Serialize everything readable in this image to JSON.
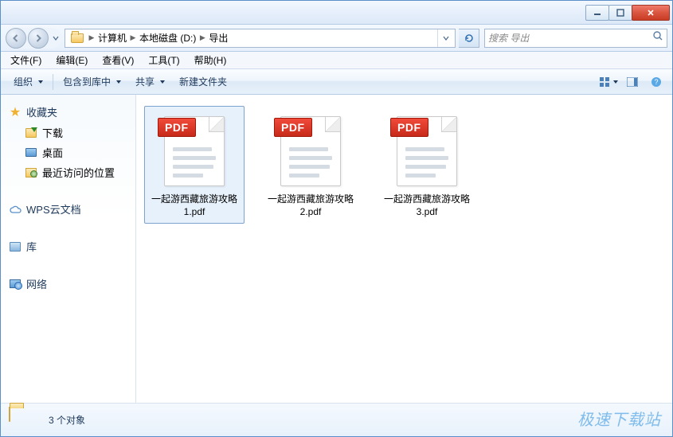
{
  "window_controls": {
    "minimize": "min",
    "maximize": "max",
    "close": "close"
  },
  "breadcrumb": {
    "items": [
      "计算机",
      "本地磁盘 (D:)",
      "导出"
    ]
  },
  "search": {
    "placeholder": "搜索 导出"
  },
  "menubar": {
    "file": "文件(F)",
    "edit": "编辑(E)",
    "view": "查看(V)",
    "tools": "工具(T)",
    "help": "帮助(H)"
  },
  "toolbar": {
    "organize": "组织",
    "include": "包含到库中",
    "share": "共享",
    "newfolder": "新建文件夹"
  },
  "sidebar": {
    "favorites": {
      "label": "收藏夹"
    },
    "downloads": {
      "label": "下载"
    },
    "desktop": {
      "label": "桌面"
    },
    "recent": {
      "label": "最近访问的位置"
    },
    "wps": {
      "label": "WPS云文档"
    },
    "libraries": {
      "label": "库"
    },
    "network": {
      "label": "网络"
    }
  },
  "files": [
    {
      "name": "一起游西藏旅游攻略 1.pdf",
      "badge": "PDF",
      "selected": true
    },
    {
      "name": "一起游西藏旅游攻略 2.pdf",
      "badge": "PDF",
      "selected": false
    },
    {
      "name": "一起游西藏旅游攻略 3.pdf",
      "badge": "PDF",
      "selected": false
    }
  ],
  "statusbar": {
    "count_text": "3 个对象"
  },
  "watermark": "极速下载站"
}
